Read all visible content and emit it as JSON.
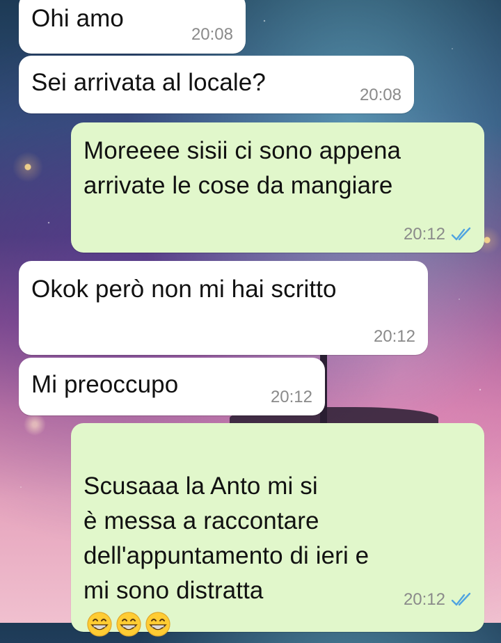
{
  "messages": [
    {
      "direction": "incoming",
      "text": "Ohi amo",
      "time": "20:08"
    },
    {
      "direction": "incoming",
      "text": "Sei arrivata al locale?",
      "time": "20:08"
    },
    {
      "direction": "outgoing",
      "text": "Moreeee sisii ci sono appena\narrivate le cose da mangiare",
      "time": "20:12",
      "status": "read-ticks-icon"
    },
    {
      "direction": "incoming",
      "text": "Okok però non mi hai scritto",
      "time": "20:12"
    },
    {
      "direction": "incoming",
      "text": "Mi preoccupo",
      "time": "20:12"
    },
    {
      "direction": "outgoing",
      "text": "Scusaaa la Anto mi si\nè messa a raccontare\ndell'appuntamento di ieri e\nmi sono distratta",
      "time": "20:12",
      "status": "read-ticks-icon",
      "emojis": [
        "grinning-face-icon",
        "grinning-face-icon",
        "grinning-face-icon"
      ]
    }
  ],
  "colors": {
    "incoming_bubble": "#ffffff",
    "outgoing_bubble": "#e1f7cb",
    "time_text": "#8a8a8a",
    "read_ticks": "#4fa3e0"
  }
}
